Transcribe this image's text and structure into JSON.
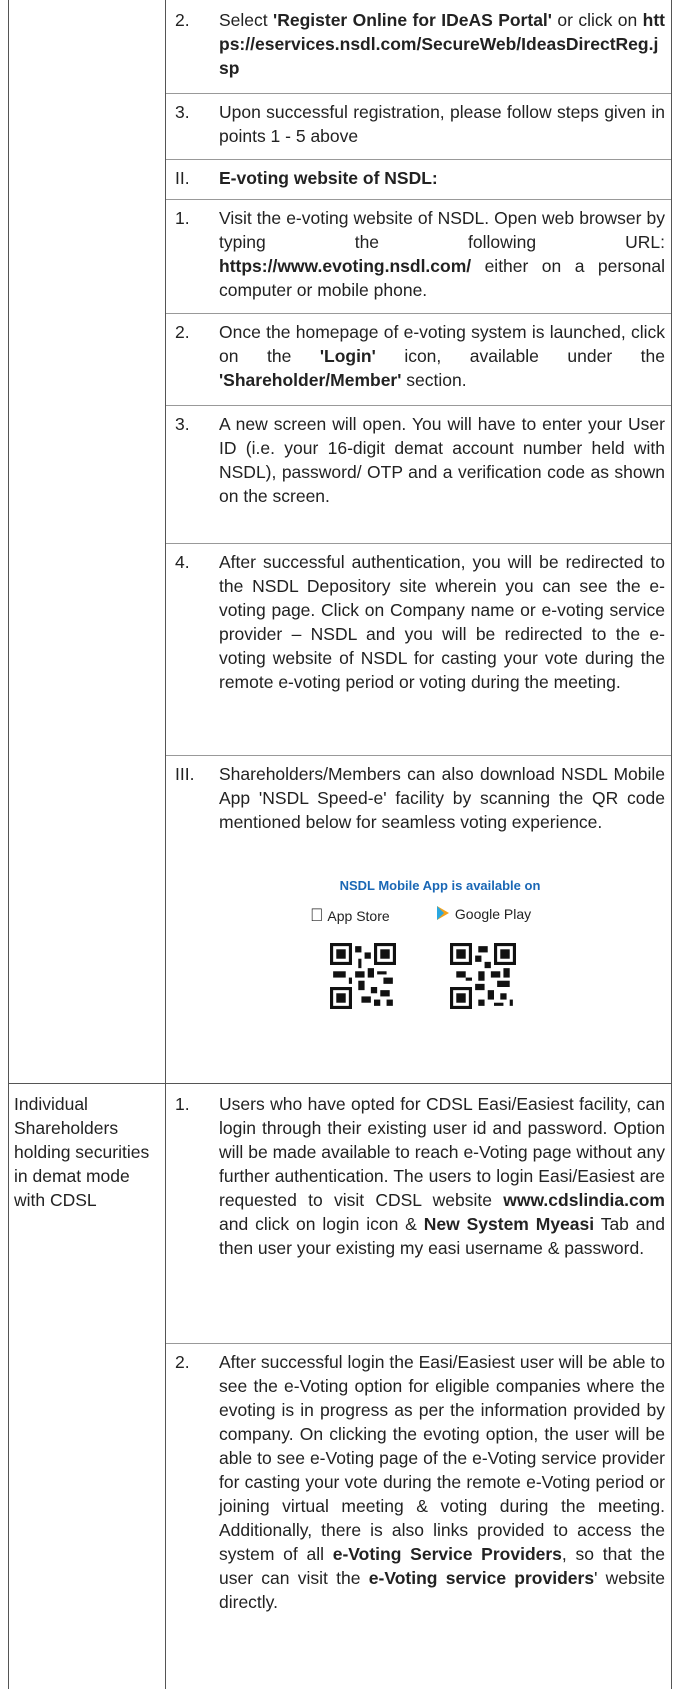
{
  "top_section": {
    "item2": {
      "num": "2.",
      "pre": "Select ",
      "bold1": "'Register Online for IDeAS Portal'",
      "mid": " or click on ",
      "link": "https://eservices.nsdl.com/SecureWeb/IdeasDirectReg.jsp"
    },
    "item3": {
      "num": "3.",
      "text": "Upon successful registration, please follow steps given in points 1 - 5 above"
    },
    "heading_ii": {
      "num": "II.",
      "text": "E-voting website of NSDL:"
    },
    "ev1": {
      "num": "1.",
      "pre": "Visit the e-voting website of NSDL. Open web browser by typing the following URL: ",
      "link": "https://www.evoting.nsdl.com/",
      "post": " either on a personal computer or mobile phone."
    },
    "ev2": {
      "num": "2.",
      "pre": "Once the homepage of e-voting system is launched, click on the ",
      "bold1": "'Login'",
      "mid": " icon, available under the ",
      "bold2": "'Shareholder/Member'",
      "post": " section."
    },
    "ev3": {
      "num": "3.",
      "text": "A new screen will open. You will have to enter your User ID (i.e. your 16-digit demat account number held with NSDL), password/ OTP and a verification code as shown on the screen."
    },
    "ev4": {
      "num": "4.",
      "text": "After successful authentication, you will be redirected to the NSDL Depository site wherein you can see the e-voting page. Click on Company name or e-voting service provider – NSDL and you will be redirected to the e-voting website of NSDL for casting your vote during the remote e-voting period or voting during the meeting."
    },
    "heading_iii": {
      "num": "III.",
      "text": "Shareholders/Members can also download NSDL Mobile App 'NSDL Speed-e' facility by scanning the QR code mentioned below for seamless voting experience."
    },
    "app": {
      "label": "NSDL Mobile App is available on",
      "app_store": "App Store",
      "google_play": "Google Play"
    }
  },
  "cdsl_section": {
    "left_label": "Individual Shareholders holding securities in demat mode with CDSL",
    "item1": {
      "num": "1.",
      "pre": "Users who have opted for CDSL Easi/Easiest facility, can login through their existing user id and password. Option will be made available to reach e-Voting page without any further authentication. The users to login Easi/Easiest are requested to visit CDSL website ",
      "bold1": "www.cdslindia.com",
      "mid": " and click on login icon & ",
      "bold2": "New System Myeasi",
      "post": " Tab and then user your existing my easi username & password."
    },
    "item2": {
      "num": "2.",
      "pre": "After successful login the Easi/Easiest user will be able to see the e-Voting option for eligible companies where the evoting is in progress as per the information provided by company. On clicking the evoting option, the user will be able to see e-Voting page of the e-Voting service provider for casting your vote during the remote e-Voting period or joining virtual meeting & voting during the meeting. Additionally, there is also links provided to access the system of all ",
      "bold1": "e-Voting Service Providers",
      "mid": ", so that the user can visit the ",
      "bold2": "e-Voting service providers",
      "post": "' website directly."
    }
  }
}
